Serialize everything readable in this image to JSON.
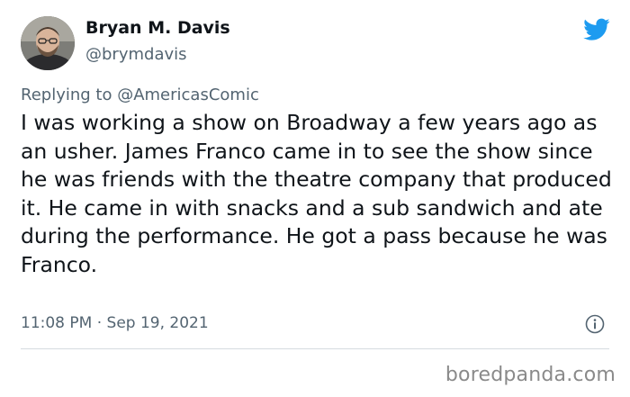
{
  "tweet": {
    "display_name": "Bryan M. Davis",
    "handle": "@brymdavis",
    "reply_prefix": "Replying to ",
    "reply_to": "@AmericasComic",
    "body": "I was working a show on Broadway a few years ago as an usher. James Franco came in to see the show since he was friends with the theatre company that produced it. He came in with snacks and a sub sandwich and ate during the performance. He got a pass because he was Franco.",
    "timestamp": "11:08 PM · Sep 19, 2021"
  },
  "watermark": "boredpanda.com",
  "icons": {
    "platform": "twitter-bird-icon",
    "info": "info-icon",
    "avatar": "profile-photo"
  },
  "colors": {
    "twitter_blue": "#1d9bf0",
    "text_primary": "#0f1419",
    "text_secondary": "#536471",
    "watermark": "#8a8a8a"
  }
}
